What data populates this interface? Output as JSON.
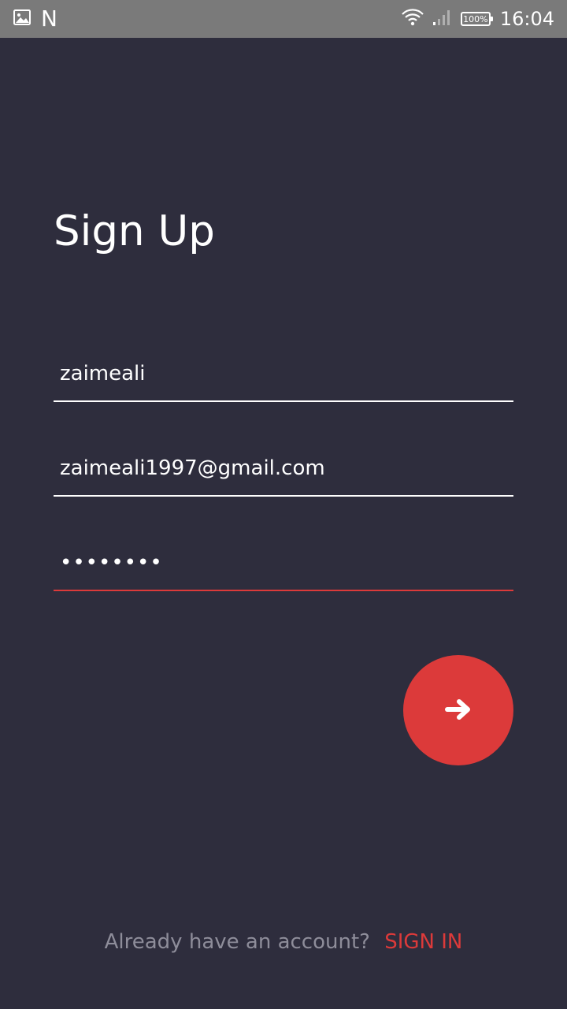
{
  "status_bar": {
    "left_icons": [
      "image-icon",
      "n-icon"
    ],
    "n_label": "N",
    "battery": "100%",
    "time": "16:04",
    "right_icons": [
      "wifi-icon",
      "signal-icon",
      "battery-icon"
    ]
  },
  "signup": {
    "title": "Sign Up",
    "username_value": "zaimeali",
    "email_value": "zaimeali1997@gmail.com",
    "password_value": "••••••••",
    "submit_icon": "arrow-right-icon"
  },
  "footer": {
    "prompt": "Already have an account?",
    "link": "SIGN IN"
  },
  "colors": {
    "background": "#2e2d3d",
    "status_bar": "#7a7a7a",
    "accent": "#dc3a3a",
    "muted_text": "#8e8d9a"
  }
}
